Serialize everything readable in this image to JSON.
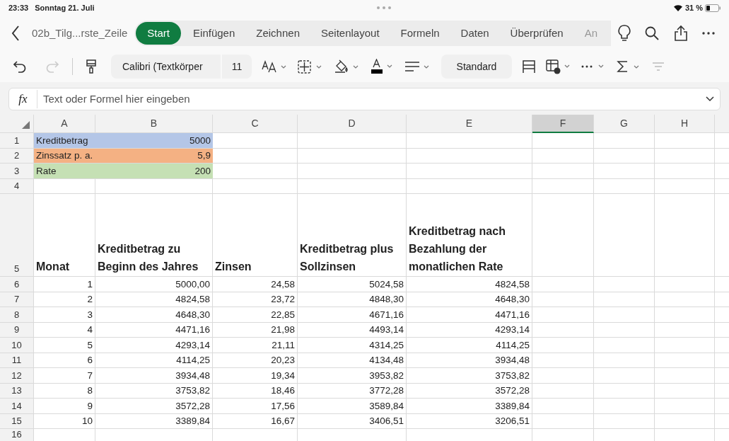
{
  "status_bar": {
    "time": "23:33",
    "date": "Sonntag 21. Juli",
    "battery": "31 %"
  },
  "ribbon": {
    "file_name": "02b_Tilg...rste_Zeile",
    "tabs": [
      {
        "label": "Start",
        "selected": true
      },
      {
        "label": "Einfügen",
        "selected": false
      },
      {
        "label": "Zeichnen",
        "selected": false
      },
      {
        "label": "Seitenlayout",
        "selected": false
      },
      {
        "label": "Formeln",
        "selected": false
      },
      {
        "label": "Daten",
        "selected": false
      },
      {
        "label": "Überprüfen",
        "selected": false
      },
      {
        "label": "An",
        "selected": false
      }
    ]
  },
  "toolbar": {
    "font": "Calibri (Textkörper",
    "size": "11",
    "number_format": "Standard"
  },
  "formula_bar": {
    "label": "fx",
    "placeholder": "Text oder Formel hier eingeben"
  },
  "sheet": {
    "columns": [
      {
        "label": "A",
        "selected": false
      },
      {
        "label": "B",
        "selected": false
      },
      {
        "label": "C",
        "selected": false
      },
      {
        "label": "D",
        "selected": false
      },
      {
        "label": "E",
        "selected": false
      },
      {
        "label": "F",
        "selected": true
      },
      {
        "label": "G",
        "selected": false
      },
      {
        "label": "H",
        "selected": false
      }
    ],
    "rows": [
      {
        "number": "1",
        "kind": "input",
        "label": "Kreditbetrag",
        "value": "5000",
        "color": "#b4c6e7"
      },
      {
        "number": "2",
        "kind": "input",
        "label": "Zinssatz p. a.",
        "value": "5,9",
        "color": "#f4b183"
      },
      {
        "number": "3",
        "kind": "input",
        "label": "Rate",
        "value": "200",
        "color": "#c5e0b4"
      },
      {
        "number": "4",
        "kind": "blank"
      },
      {
        "number": "5",
        "kind": "header",
        "cells": [
          "Monat",
          "Kreditbetrag zu Beginn des Jahres",
          "Zinsen",
          "Kreditbetrag plus Sollzinsen",
          "Kreditbetrag nach Bezahlung der monatlichen Rate"
        ]
      },
      {
        "number": "6",
        "kind": "data",
        "cells": [
          "1",
          "5000,00",
          "24,58",
          "5024,58",
          "4824,58"
        ]
      },
      {
        "number": "7",
        "kind": "data",
        "cells": [
          "2",
          "4824,58",
          "23,72",
          "4848,30",
          "4648,30"
        ]
      },
      {
        "number": "8",
        "kind": "data",
        "cells": [
          "3",
          "4648,30",
          "22,85",
          "4671,16",
          "4471,16"
        ]
      },
      {
        "number": "9",
        "kind": "data",
        "cells": [
          "4",
          "4471,16",
          "21,98",
          "4493,14",
          "4293,14"
        ]
      },
      {
        "number": "10",
        "kind": "data",
        "cells": [
          "5",
          "4293,14",
          "21,11",
          "4314,25",
          "4114,25"
        ]
      },
      {
        "number": "11",
        "kind": "data",
        "cells": [
          "6",
          "4114,25",
          "20,23",
          "4134,48",
          "3934,48"
        ]
      },
      {
        "number": "12",
        "kind": "data",
        "cells": [
          "7",
          "3934,48",
          "19,34",
          "3953,82",
          "3753,82"
        ]
      },
      {
        "number": "13",
        "kind": "data",
        "cells": [
          "8",
          "3753,82",
          "18,46",
          "3772,28",
          "3572,28"
        ]
      },
      {
        "number": "14",
        "kind": "data",
        "cells": [
          "9",
          "3572,28",
          "17,56",
          "3589,84",
          "3389,84"
        ]
      },
      {
        "number": "15",
        "kind": "data",
        "cells": [
          "10",
          "3389,84",
          "16,67",
          "3406,51",
          "3206,51"
        ]
      },
      {
        "number": "16",
        "kind": "blank"
      }
    ]
  }
}
